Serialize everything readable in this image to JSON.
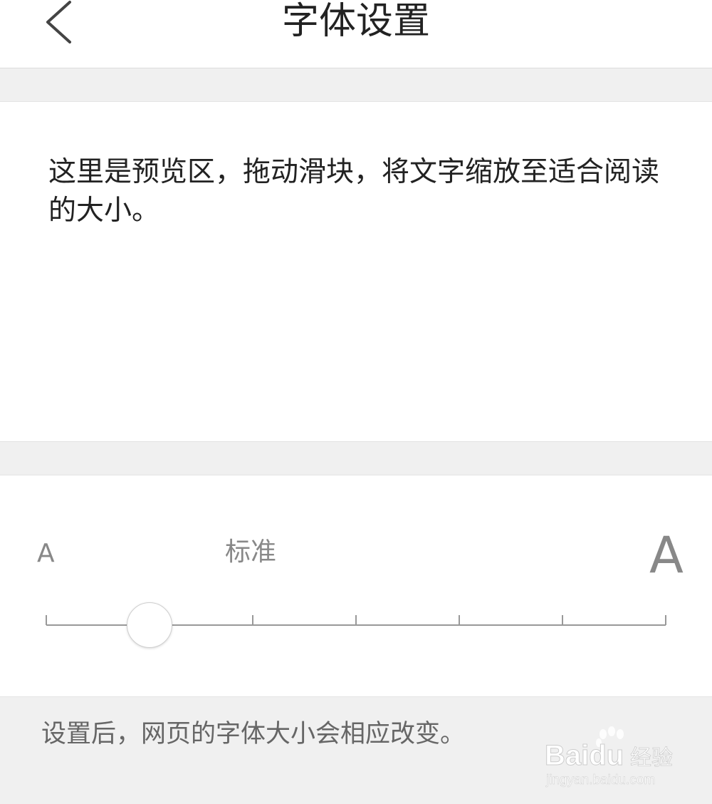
{
  "header": {
    "title": "字体设置",
    "back_icon": "chevron-left-icon"
  },
  "preview": {
    "text": "这里是预览区，拖动滑块，将文字缩放至适合阅读的大小。"
  },
  "font_slider": {
    "min_label": "A",
    "standard_label": "标准",
    "max_label": "A",
    "steps": 7,
    "selected_index": 1
  },
  "footer": {
    "note": "设置后，网页的字体大小会相应改变。"
  },
  "watermark": {
    "brand": "Baidu",
    "product": "经验",
    "url": "jingyan.baidu.com"
  },
  "colors": {
    "background": "#f0f0f0",
    "panel": "#ffffff",
    "text_primary": "#222222",
    "text_secondary": "#888888",
    "track": "#999999"
  }
}
